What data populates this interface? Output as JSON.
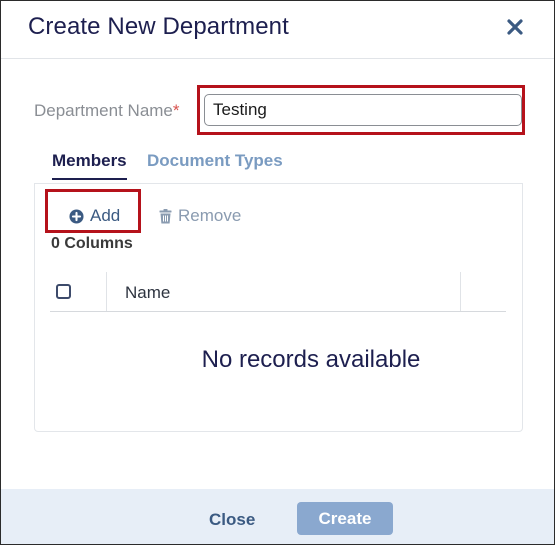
{
  "dialog": {
    "title": "Create New Department",
    "close_icon": "close-x-icon"
  },
  "form": {
    "department_label": "Department Name",
    "required_marker": "*",
    "department_value": "Testing"
  },
  "tabs": [
    {
      "label": "Members",
      "active": true
    },
    {
      "label": "Document Types",
      "active": false
    }
  ],
  "toolbar": {
    "add_label": "Add",
    "add_icon": "plus-circle-icon",
    "remove_label": "Remove",
    "remove_icon": "trash-icon"
  },
  "grid": {
    "column_count_text": "0 Columns",
    "columns": [
      "Name"
    ],
    "empty_message": "No records available"
  },
  "footer": {
    "close_label": "Close",
    "create_label": "Create"
  },
  "colors": {
    "title": "#1d1f4f",
    "highlight": "#b5121b",
    "footer_bg": "#e7eef7",
    "create_bg": "#8aa8cf",
    "link": "#3b5a82"
  }
}
